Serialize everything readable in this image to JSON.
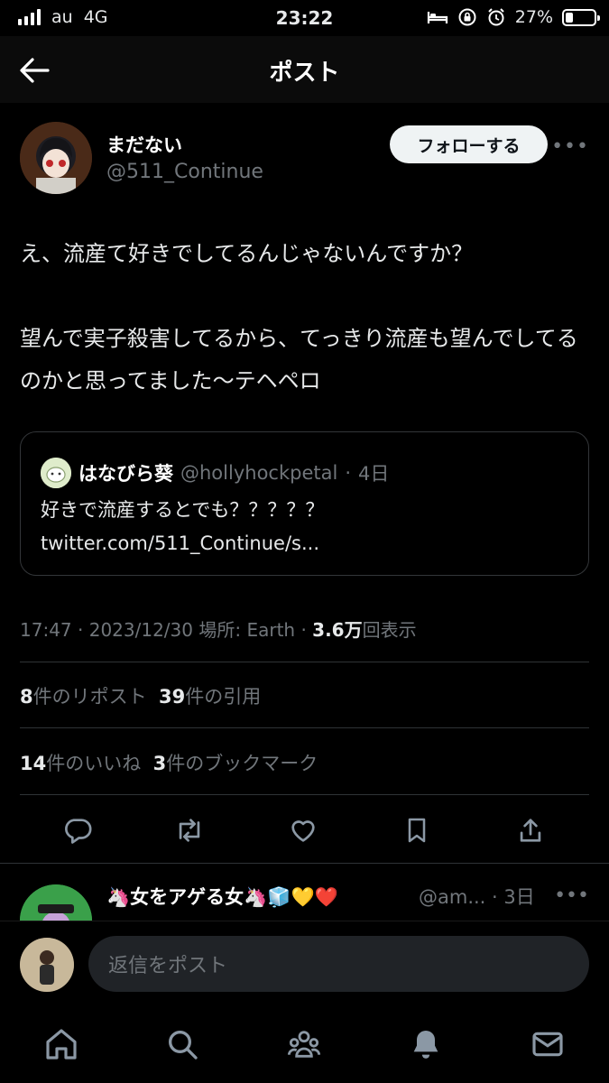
{
  "status_bar": {
    "carrier": "au",
    "network": "4G",
    "time": "23:22",
    "battery_percent": "27%",
    "battery_level": 0.27,
    "icons": [
      "signal-icon",
      "bed-icon",
      "rotation-lock-icon",
      "alarm-icon",
      "battery-icon"
    ]
  },
  "header": {
    "title": "ポスト",
    "back_icon": "back-arrow-icon"
  },
  "post": {
    "author_name": "まだない",
    "author_handle": "@511_Continue",
    "follow_label": "フォローする",
    "more_icon": "more-icon",
    "more_glyph": "•••",
    "text": "え、流産て好きでしてるんじゃないんですか？\n\n望んで実子殺害してるから、てっきり流産も望んでしてるのかと思ってました〜テヘペロ",
    "quote": {
      "name": "はなびら葵",
      "handle": "@hollyhockpetal",
      "separator": "·",
      "age": "4日",
      "text": "好きで流産するとでも？？？？？ twitter.com/511_Continue/s..."
    },
    "meta": {
      "time": "17:47",
      "date": "2023/12/30",
      "location_label": "場所: Earth",
      "views_count": "3.6万",
      "views_label": "回表示"
    },
    "stats": {
      "reposts_count": "8",
      "reposts_label": "件のリポスト",
      "quotes_count": "39",
      "quotes_label": "件の引用",
      "likes_count": "14",
      "likes_label": "件のいいね",
      "bookmarks_count": "3",
      "bookmarks_label": "件のブックマーク"
    },
    "actions": [
      "reply-icon",
      "repost-icon",
      "like-icon",
      "bookmark-icon",
      "share-icon"
    ]
  },
  "reply": {
    "name": "🦄女をアゲる女🦄🧊💛❤️",
    "handle": "@am...",
    "separator": "·",
    "age": "3日",
    "more_glyph": "•••"
  },
  "compose": {
    "placeholder": "返信をポスト"
  },
  "tab_bar": {
    "tabs": [
      "home-icon",
      "search-icon",
      "communities-icon",
      "notifications-icon",
      "messages-icon"
    ]
  },
  "colors": {
    "background": "#000000",
    "text": "#e7e9ea",
    "muted": "#71767b",
    "divider": "#2f3336",
    "follow_bg": "#eff3f4"
  }
}
